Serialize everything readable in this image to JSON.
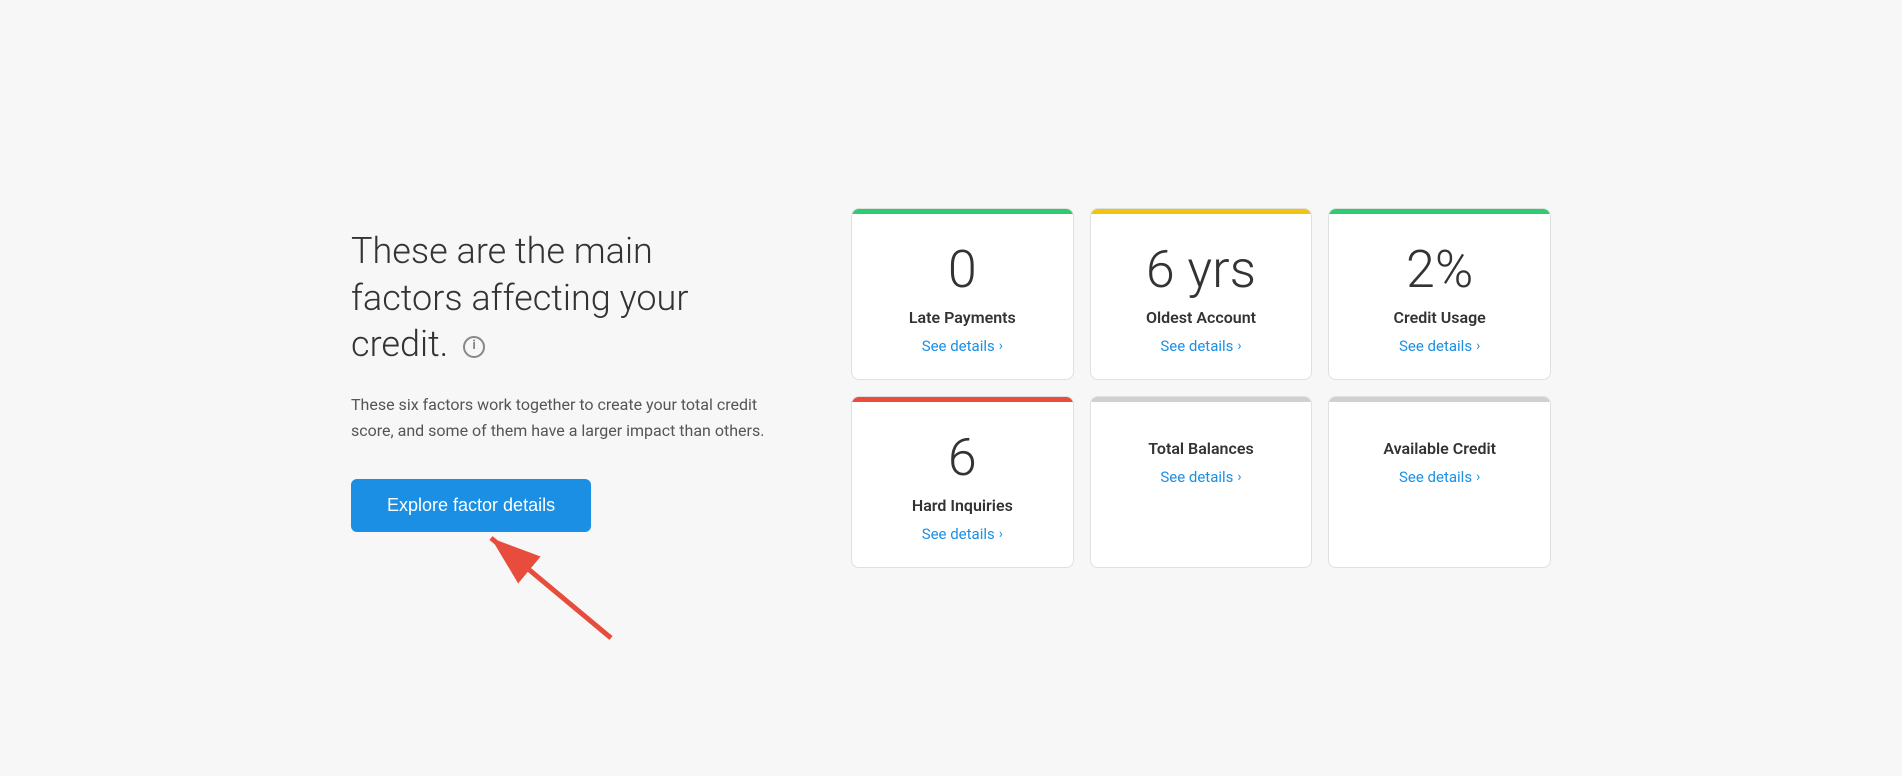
{
  "left": {
    "heading": "These are the main factors affecting your credit.",
    "subtext": "These six factors work together to create your total credit score, and some of them have a larger impact than others.",
    "explore_button": "Explore factor details",
    "info_icon_label": "i"
  },
  "cards": [
    {
      "id": "late-payments",
      "value": "0",
      "label": "Late Payments",
      "link": "See details",
      "color_class": "card-green"
    },
    {
      "id": "oldest-account",
      "value": "6 yrs",
      "label": "Oldest Account",
      "link": "See details",
      "color_class": "card-yellow"
    },
    {
      "id": "credit-usage",
      "value": "2%",
      "label": "Credit Usage",
      "link": "See details",
      "color_class": "card-green"
    },
    {
      "id": "hard-inquiries",
      "value": "6",
      "label": "Hard Inquiries",
      "link": "See details",
      "color_class": "card-red"
    },
    {
      "id": "total-balances",
      "value": "",
      "label": "Total Balances",
      "link": "See details",
      "color_class": "card-gray"
    },
    {
      "id": "available-credit",
      "value": "",
      "label": "Available Credit",
      "link": "See details",
      "color_class": "card-gray"
    }
  ],
  "chevron": "›",
  "arrow": {
    "color": "#e74c3c"
  }
}
